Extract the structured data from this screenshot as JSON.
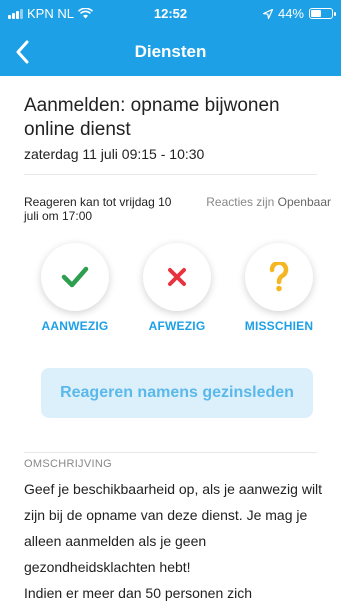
{
  "status_bar": {
    "carrier": "KPN NL",
    "time": "12:52",
    "battery": "44%",
    "battery_level": 0.44
  },
  "nav": {
    "title": "Diensten"
  },
  "event": {
    "title": "Aanmelden: opname bijwonen online dienst",
    "datetime": "zaterdag 11 juli 09:15 - 10:30"
  },
  "meta": {
    "deadline": "Reageren kan tot vrijdag 10 juli om 17:00",
    "visibility_prefix": "Reacties zijn ",
    "visibility_value": "Openbaar"
  },
  "responses": [
    {
      "label": "AANWEZIG",
      "icon": "check-icon",
      "color": "#2e9e4f"
    },
    {
      "label": "AFWEZIG",
      "icon": "cross-icon",
      "color": "#e8333f"
    },
    {
      "label": "MISSCHIEN",
      "icon": "question-icon",
      "color": "#f5b623"
    }
  ],
  "family_button": {
    "label": "Reageren namens gezinsleden"
  },
  "description": {
    "heading": "OMSCHRIJVING",
    "body": "Geef je beschikbaarheid op, als je aanwezig wilt zijn bij de opname van deze dienst. Je mag je alleen aanmelden als je geen gezondheidsklachten hebt!\nIndien er meer dan 50 personen zich"
  },
  "colors": {
    "accent": "#1ea0e6",
    "button_bg": "#dcf0fb"
  }
}
